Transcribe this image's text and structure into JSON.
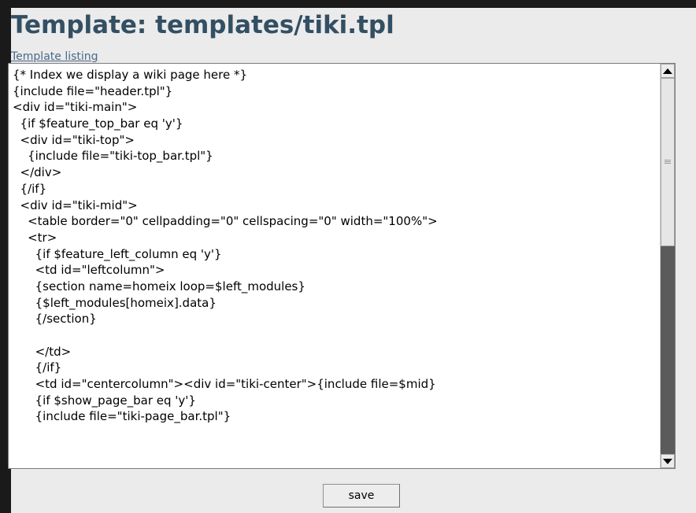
{
  "page": {
    "title": "Template: templates/tiki.tpl",
    "listing_link": "Template listing"
  },
  "editor": {
    "lines": [
      "{* Index we display a wiki page here *}",
      "{include file=\"header.tpl\"}",
      "<div id=\"tiki-main\">",
      "  {if $feature_top_bar eq 'y'}",
      "  <div id=\"tiki-top\">",
      "    {include file=\"tiki-top_bar.tpl\"}",
      "  </div>",
      "  {/if}",
      "  <div id=\"tiki-mid\">",
      "    <table border=\"0\" cellpadding=\"0\" cellspacing=\"0\" width=\"100%\">",
      "    <tr>",
      "      {if $feature_left_column eq 'y'}",
      "      <td id=\"leftcolumn\">",
      "      {section name=homeix loop=$left_modules}",
      "      {$left_modules[homeix].data}",
      "      {/section}",
      "",
      "      </td>",
      "      {/if}",
      "      <td id=\"centercolumn\"><div id=\"tiki-center\">{include file=$mid}",
      "      {if $show_page_bar eq 'y'}",
      "      {include file=\"tiki-page_bar.tpl\"}"
    ]
  },
  "actions": {
    "save_label": "save"
  }
}
